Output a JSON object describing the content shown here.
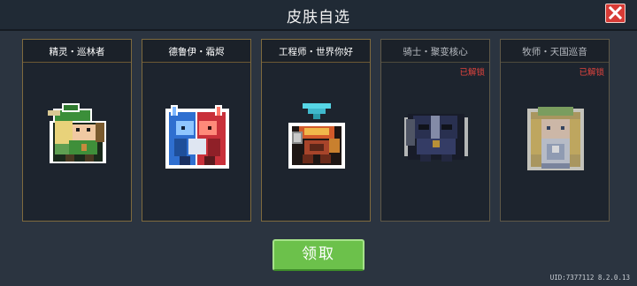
{
  "header": {
    "title": "皮肤自选"
  },
  "close": {
    "icon": "close-icon"
  },
  "skins": [
    {
      "name": "精灵・巡林者",
      "status": "",
      "sprite": "elf-ranger-sprite"
    },
    {
      "name": "德鲁伊・霜烬",
      "status": "",
      "sprite": "druid-frost-ember-sprite"
    },
    {
      "name": "工程师・世界你好",
      "status": "",
      "sprite": "engineer-hello-world-sprite"
    },
    {
      "name": "骑士・聚变核心",
      "status": "已解锁",
      "sprite": "knight-fusion-core-sprite"
    },
    {
      "name": "牧师・天国巡音",
      "status": "已解锁",
      "sprite": "priest-heavenly-sprite"
    }
  ],
  "claim_button": {
    "label": "领取"
  },
  "footer": {
    "uid_text": "UID:7377112  8.2.0.13"
  },
  "colors": {
    "accent_green": "#6cc14b",
    "unlocked_red": "#e0433d",
    "card_border": "#7e6a3e"
  }
}
